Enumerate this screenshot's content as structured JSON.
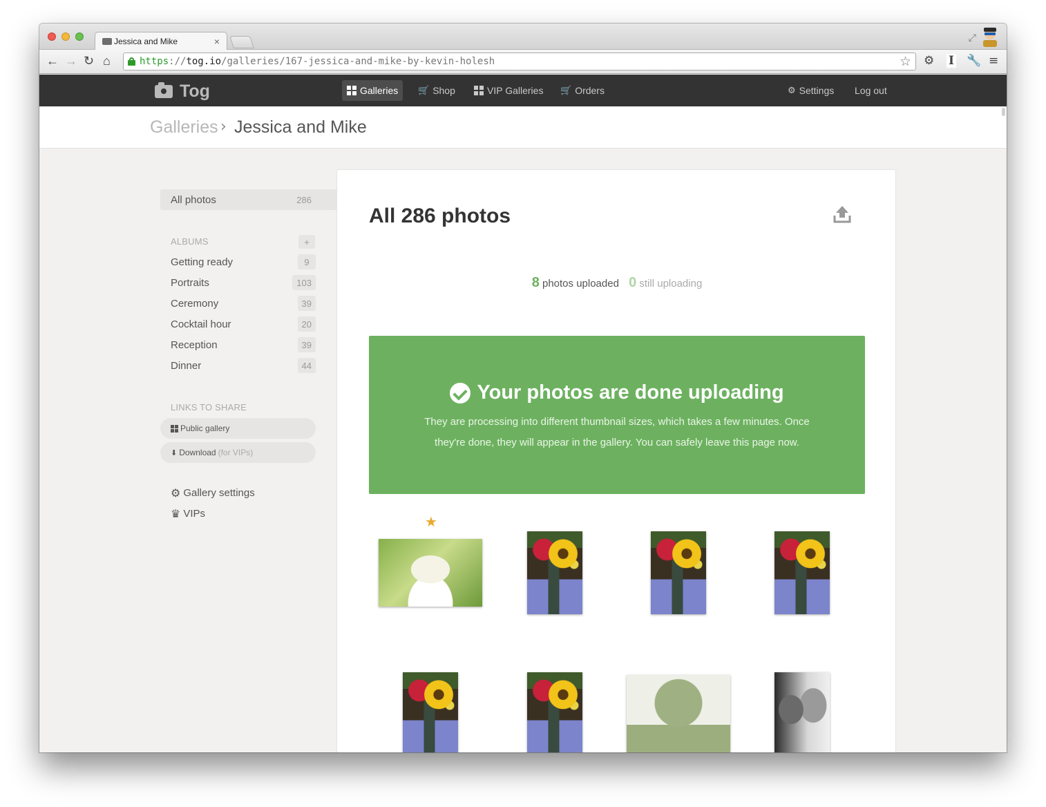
{
  "browser": {
    "tab_title": "Jessica and Mike",
    "tab_close": "×",
    "url_scheme": "https",
    "url_sep": "://",
    "url_host": "tog.io",
    "url_path": "/galleries/167-jessica-and-mike-by-kevin-holesh"
  },
  "app": {
    "logo_text": "Tog",
    "nav": [
      {
        "label": "Galleries",
        "icon": "grid-icon",
        "active": true
      },
      {
        "label": "Shop",
        "icon": "cart-icon"
      },
      {
        "label": "VIP Galleries",
        "icon": "grid-icon"
      },
      {
        "label": "Orders",
        "icon": "cart-icon"
      }
    ],
    "settings_label": "Settings",
    "logout_label": "Log out"
  },
  "breadcrumb": {
    "parent": "Galleries",
    "current": "Jessica and Mike"
  },
  "sidebar": {
    "all_photos": {
      "label": "All photos",
      "count": "286"
    },
    "albums_heading": "ALBUMS",
    "add_album": "+",
    "albums": [
      {
        "label": "Getting ready",
        "count": "9"
      },
      {
        "label": "Portraits",
        "count": "103"
      },
      {
        "label": "Ceremony",
        "count": "39"
      },
      {
        "label": "Cocktail hour",
        "count": "20"
      },
      {
        "label": "Reception",
        "count": "39"
      },
      {
        "label": "Dinner",
        "count": "44"
      }
    ],
    "links_heading": "LINKS TO SHARE",
    "public_gallery": "Public gallery",
    "download": "Download",
    "download_note": "(for VIPs)",
    "gallery_settings": "Gallery settings",
    "vips": "VIPs"
  },
  "main": {
    "title": "All 286 photos",
    "uploaded_count": "8",
    "uploaded_label": "photos uploaded",
    "uploading_count": "0",
    "uploading_label": "still uploading",
    "banner_title": "Your photos are done uploading",
    "banner_body": "They are processing into different thumbnail sizes, which takes a few minutes. Once they're done, they will appear in the gallery. You can safely leave this page now."
  },
  "colors": {
    "success_green": "#6db160",
    "nav_bg": "#333333",
    "favorite_star": "#e8a92f"
  }
}
